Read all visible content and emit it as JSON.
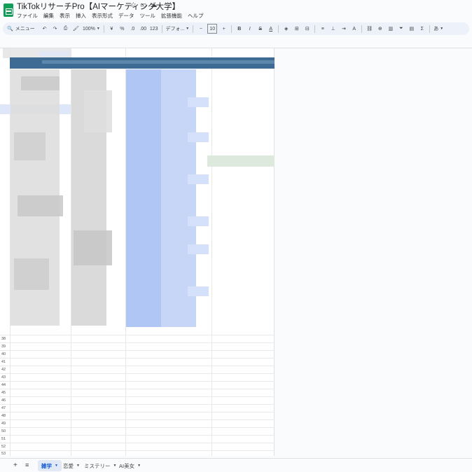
{
  "doc": {
    "title": "TikTokリサーチPro【AIマーケティング大学】"
  },
  "menu": [
    "ファイル",
    "編集",
    "表示",
    "挿入",
    "表示形式",
    "データ",
    "ツール",
    "拡張機能",
    "ヘルプ"
  ],
  "toolbar": {
    "search": "メニュー",
    "zoom": "100%",
    "currency": "¥",
    "percent": "%",
    "dec_less": ".0",
    "dec_more": ".00",
    "numfmt": "123",
    "font": "デフォ...",
    "minus": "−",
    "font_size": "10",
    "plus": "+",
    "bold": "B",
    "italic": "I",
    "strike": "S",
    "textcolor": "A",
    "sigma": "Σ",
    "input_tool": "あ"
  },
  "rows_visible": [
    "38",
    "39",
    "40",
    "41",
    "42",
    "43",
    "44",
    "45",
    "46",
    "47",
    "48",
    "49",
    "50",
    "51",
    "52",
    "53"
  ],
  "sheets": [
    {
      "label": "雑学",
      "active": true
    },
    {
      "label": "恋愛",
      "active": false
    },
    {
      "label": "ミステリー",
      "active": false
    },
    {
      "label": "AI美女",
      "active": false
    }
  ],
  "colors": {
    "header_band": "#3d6b94",
    "accent": "#0b57d0",
    "brand": "#0f9d58"
  }
}
